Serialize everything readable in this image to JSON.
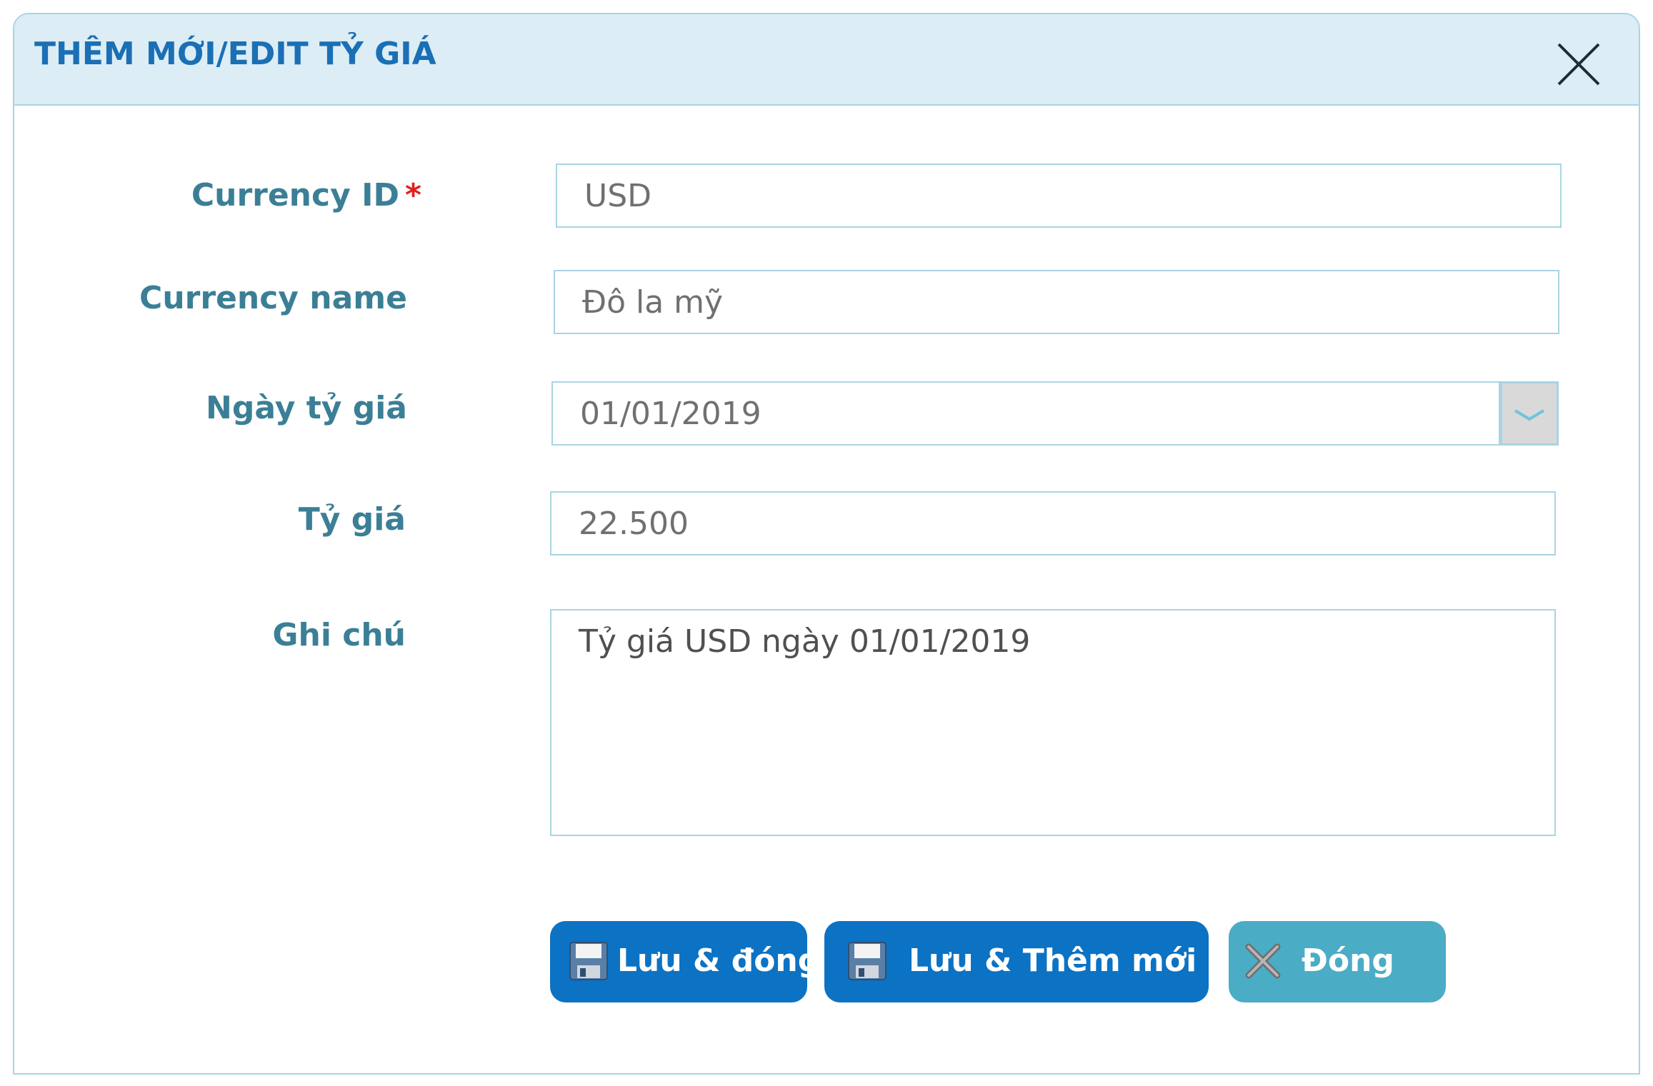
{
  "dialog": {
    "title": "THÊM MỚI/EDIT TỶ GIÁ"
  },
  "form": {
    "currency_id": {
      "label": "Currency ID",
      "required_marker": "*",
      "value": "USD"
    },
    "currency_name": {
      "label": "Currency name",
      "value": "Đô la mỹ"
    },
    "rate_date": {
      "label": "Ngày tỷ giá",
      "value": "01/01/2019"
    },
    "rate": {
      "label": "Tỷ giá",
      "value": "22.500"
    },
    "note": {
      "label": "Ghi chú",
      "value": "Tỷ giá USD ngày 01/01/2019"
    }
  },
  "buttons": {
    "save_close": "Lưu & đóng",
    "save_new": "Lưu & Thêm mới",
    "close": "Đóng"
  },
  "colors": {
    "header_bg": "#dcedf5",
    "title": "#1b6fb5",
    "label": "#3b7f96",
    "border": "#a9d4e3",
    "primary_button": "#0c72c4",
    "secondary_button": "#4bacc6",
    "required": "#e02020"
  },
  "icons": {
    "close": "close-icon",
    "date_picker": "chevron-down-icon",
    "save": "floppy-disk-icon",
    "cancel": "x-mark-icon"
  }
}
